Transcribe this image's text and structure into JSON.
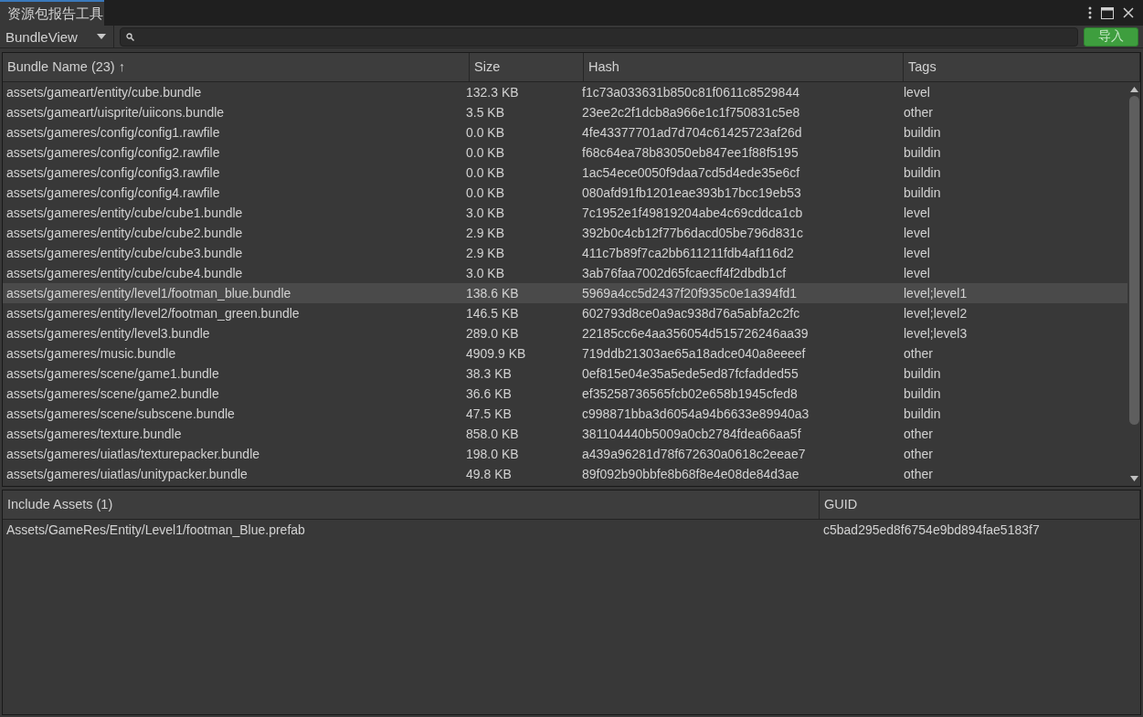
{
  "window": {
    "title": "资源包报告工具"
  },
  "toolbar": {
    "view_dropdown": "BundleView",
    "import_button": "导入"
  },
  "bundle_table": {
    "columns": [
      "Bundle Name (23) ↑",
      "Size",
      "Hash",
      "Tags"
    ],
    "rows": [
      {
        "name": "assets/gameart/entity/cube.bundle",
        "size": "132.3 KB",
        "hash": "f1c73a033631b850c81f0611c8529844",
        "tags": "level",
        "selected": false
      },
      {
        "name": "assets/gameart/uisprite/uiicons.bundle",
        "size": "3.5 KB",
        "hash": "23ee2c2f1dcb8a966e1c1f750831c5e8",
        "tags": "other",
        "selected": false
      },
      {
        "name": "assets/gameres/config/config1.rawfile",
        "size": "0.0 KB",
        "hash": "4fe43377701ad7d704c61425723af26d",
        "tags": "buildin",
        "selected": false
      },
      {
        "name": "assets/gameres/config/config2.rawfile",
        "size": "0.0 KB",
        "hash": "f68c64ea78b83050eb847ee1f88f5195",
        "tags": "buildin",
        "selected": false
      },
      {
        "name": "assets/gameres/config/config3.rawfile",
        "size": "0.0 KB",
        "hash": "1ac54ece0050f9daa7cd5d4ede35e6cf",
        "tags": "buildin",
        "selected": false
      },
      {
        "name": "assets/gameres/config/config4.rawfile",
        "size": "0.0 KB",
        "hash": "080afd91fb1201eae393b17bcc19eb53",
        "tags": "buildin",
        "selected": false
      },
      {
        "name": "assets/gameres/entity/cube/cube1.bundle",
        "size": "3.0 KB",
        "hash": "7c1952e1f49819204abe4c69cddca1cb",
        "tags": "level",
        "selected": false
      },
      {
        "name": "assets/gameres/entity/cube/cube2.bundle",
        "size": "2.9 KB",
        "hash": "392b0c4cb12f77b6dacd05be796d831c",
        "tags": "level",
        "selected": false
      },
      {
        "name": "assets/gameres/entity/cube/cube3.bundle",
        "size": "2.9 KB",
        "hash": "411c7b89f7ca2bb611211fdb4af116d2",
        "tags": "level",
        "selected": false
      },
      {
        "name": "assets/gameres/entity/cube/cube4.bundle",
        "size": "3.0 KB",
        "hash": "3ab76faa7002d65fcaecff4f2dbdb1cf",
        "tags": "level",
        "selected": false
      },
      {
        "name": "assets/gameres/entity/level1/footman_blue.bundle",
        "size": "138.6 KB",
        "hash": "5969a4cc5d2437f20f935c0e1a394fd1",
        "tags": "level;level1",
        "selected": true
      },
      {
        "name": "assets/gameres/entity/level2/footman_green.bundle",
        "size": "146.5 KB",
        "hash": "602793d8ce0a9ac938d76a5abfa2c2fc",
        "tags": "level;level2",
        "selected": false
      },
      {
        "name": "assets/gameres/entity/level3.bundle",
        "size": "289.0 KB",
        "hash": "22185cc6e4aa356054d515726246aa39",
        "tags": "level;level3",
        "selected": false
      },
      {
        "name": "assets/gameres/music.bundle",
        "size": "4909.9 KB",
        "hash": "719ddb21303ae65a18adce040a8eeeef",
        "tags": "other",
        "selected": false
      },
      {
        "name": "assets/gameres/scene/game1.bundle",
        "size": "38.3 KB",
        "hash": "0ef815e04e35a5ede5ed87fcfadded55",
        "tags": "buildin",
        "selected": false
      },
      {
        "name": "assets/gameres/scene/game2.bundle",
        "size": "36.6 KB",
        "hash": "ef35258736565fcb02e658b1945cfed8",
        "tags": "buildin",
        "selected": false
      },
      {
        "name": "assets/gameres/scene/subscene.bundle",
        "size": "47.5 KB",
        "hash": "c998871bba3d6054a94b6633e89940a3",
        "tags": "buildin",
        "selected": false
      },
      {
        "name": "assets/gameres/texture.bundle",
        "size": "858.0 KB",
        "hash": "381104440b5009a0cb2784fdea66aa5f",
        "tags": "other",
        "selected": false
      },
      {
        "name": "assets/gameres/uiatlas/texturepacker.bundle",
        "size": "198.0 KB",
        "hash": "a439a96281d78f672630a0618c2eeae7",
        "tags": "other",
        "selected": false
      },
      {
        "name": "assets/gameres/uiatlas/unitypacker.bundle",
        "size": "49.8 KB",
        "hash": "89f092b90bbfe8b68f8e4e08de84d3ae",
        "tags": "other",
        "selected": false
      }
    ]
  },
  "assets_table": {
    "columns": [
      "Include Assets (1)",
      "GUID"
    ],
    "rows": [
      {
        "path": "Assets/GameRes/Entity/Level1/footman_Blue.prefab",
        "guid": "c5bad295ed8f6754e9bd894fae5183f7",
        "selected": false
      }
    ]
  }
}
